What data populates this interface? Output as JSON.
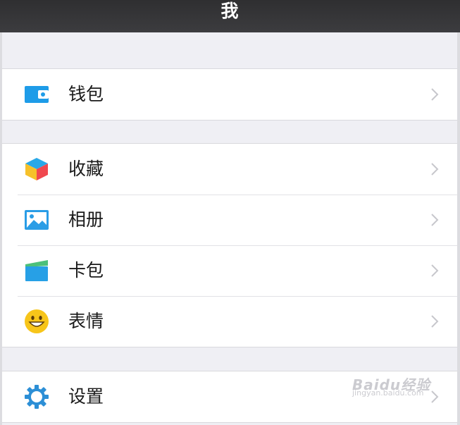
{
  "header": {
    "title": "我"
  },
  "groups": [
    {
      "items": [
        {
          "label": "钱包",
          "icon": "wallet-icon"
        }
      ]
    },
    {
      "items": [
        {
          "label": "收藏",
          "icon": "favorites-cube-icon"
        },
        {
          "label": "相册",
          "icon": "photo-album-icon"
        },
        {
          "label": "卡包",
          "icon": "card-pack-icon"
        },
        {
          "label": "表情",
          "icon": "emoji-smile-icon"
        }
      ]
    },
    {
      "items": [
        {
          "label": "设置",
          "icon": "gear-icon"
        }
      ]
    }
  ],
  "watermark": {
    "brand": "Baidu经验",
    "url": "jingyan.baidu.com"
  },
  "colors": {
    "header_bg": "#333335",
    "page_bg": "#efeff4",
    "wallet_blue": "#1e9ce8",
    "gear_blue": "#2c8fd6",
    "emoji_yellow": "#f7c51a",
    "chevron": "#c7c7cc"
  }
}
